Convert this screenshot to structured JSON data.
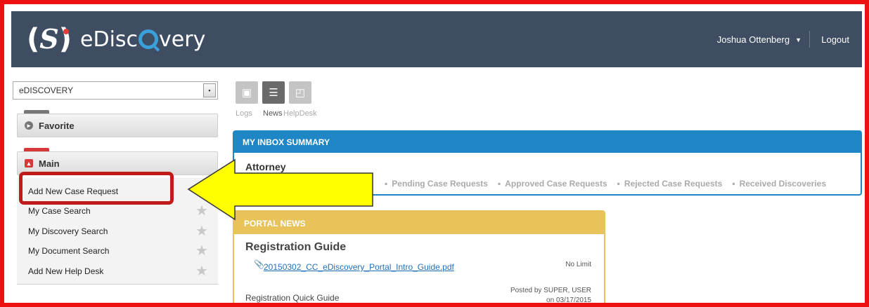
{
  "header": {
    "logo_text": "eDiscQvery",
    "logo_prefix": "eDisc",
    "logo_suffix": "very",
    "user_name": "Joshua Ottenberg",
    "logout_label": "Logout"
  },
  "sidebar": {
    "selected_option": "eDISCOVERY",
    "favorite_label": "Favorite",
    "main_label": "Main",
    "menu_items": [
      {
        "label": "Add New Case Request"
      },
      {
        "label": "My Case Search"
      },
      {
        "label": "My Discovery Search"
      },
      {
        "label": "My Document Search"
      },
      {
        "label": "Add New Help Desk"
      }
    ]
  },
  "toolbar": {
    "items": [
      {
        "label": "Logs",
        "icon": "logs-icon"
      },
      {
        "label": "News",
        "icon": "list-icon",
        "active": true
      },
      {
        "label": "HelpDesk",
        "icon": "inbox-icon"
      }
    ]
  },
  "inbox": {
    "title": "MY INBOX SUMMARY",
    "role": "Attorney",
    "links": [
      "Pending Case Requests",
      "Approved Case Requests",
      "Rejected Case Requests",
      "Received Discoveries"
    ]
  },
  "news": {
    "title": "PORTAL NEWS",
    "item_title": "Registration Guide",
    "attachment": "20150302_CC_eDiscovery_Portal_Intro_Guide.pdf",
    "limit": "No Limit",
    "description": "Registration Quick Guide",
    "posted_by": "Posted by SUPER, USER",
    "posted_on": "on 03/17/2015"
  },
  "colors": {
    "header_bg": "#3f4d63",
    "accent_blue": "#1f86c6",
    "news_gold": "#e8c35a",
    "annotation_red": "#ee1111",
    "arrow_yellow": "#ffff00"
  }
}
